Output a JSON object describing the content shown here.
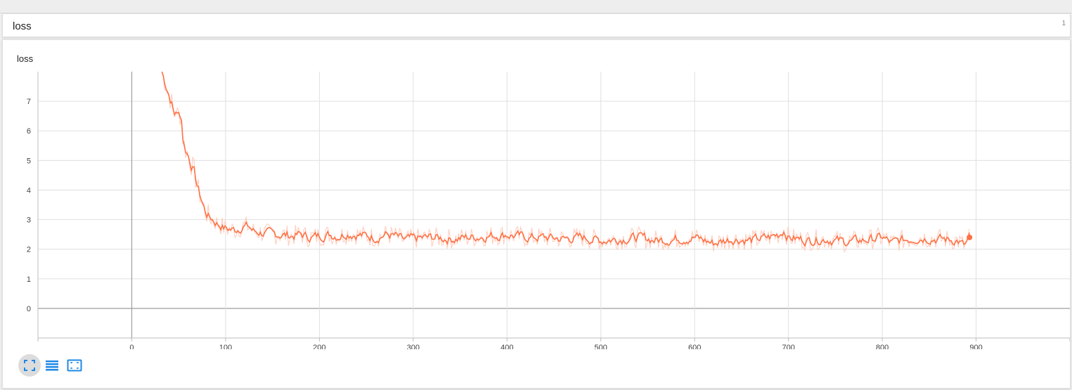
{
  "group": {
    "title": "loss",
    "count": "1"
  },
  "card": {
    "title": "loss"
  },
  "icons": {
    "fullscreen": "fullscreen-icon",
    "log_scale": "log-scale-icon",
    "fit_domain": "fit-domain-icon"
  },
  "colors": {
    "line": "#ff7043",
    "raw_line": "#ffccbc",
    "icon": "#1e88e5"
  },
  "chart_data": {
    "type": "line",
    "title": "loss",
    "xlabel": "",
    "ylabel": "",
    "xlim": [
      -100,
      1000
    ],
    "ylim": [
      -1,
      8
    ],
    "xticks": [
      0,
      100,
      200,
      300,
      400,
      500,
      600,
      700,
      800,
      900
    ],
    "yticks": [
      0,
      1,
      2,
      3,
      4,
      5,
      6,
      7
    ],
    "grid": true,
    "series": [
      {
        "values_smoothed": "approx",
        "x": [
          32,
          37,
          40,
          43,
          45,
          47,
          49,
          51,
          53,
          55,
          57,
          60,
          63,
          66,
          70,
          72,
          75,
          78,
          82,
          85,
          88,
          92,
          95,
          100,
          110,
          120,
          125,
          130,
          140,
          150,
          160,
          170,
          180,
          190,
          200,
          210,
          220,
          230,
          240,
          250,
          260,
          270,
          280,
          290,
          300,
          320,
          340,
          360,
          380,
          400,
          420,
          440,
          460,
          480,
          500,
          520,
          540,
          560,
          580,
          600,
          620,
          640,
          660,
          680,
          690,
          695,
          700,
          720,
          740,
          760,
          780,
          800,
          810,
          820,
          830,
          840,
          860,
          880,
          888,
          893
        ],
        "y": [
          8.0,
          7.5,
          7.2,
          6.9,
          6.5,
          6.7,
          6.5,
          6.6,
          6.4,
          5.6,
          5.4,
          5.2,
          4.9,
          4.7,
          4.1,
          3.9,
          3.6,
          3.3,
          3.1,
          3.05,
          2.95,
          2.85,
          2.8,
          2.7,
          2.65,
          2.8,
          2.75,
          2.6,
          2.55,
          2.5,
          2.5,
          2.45,
          2.5,
          2.4,
          2.45,
          2.5,
          2.45,
          2.55,
          2.5,
          2.45,
          2.4,
          2.5,
          2.45,
          2.3,
          2.35,
          2.4,
          2.35,
          2.4,
          2.45,
          2.5,
          2.4,
          2.4,
          2.35,
          2.4,
          2.3,
          2.35,
          2.4,
          2.3,
          2.35,
          2.4,
          2.2,
          2.35,
          2.3,
          2.4,
          2.5,
          2.65,
          2.4,
          2.3,
          2.35,
          2.25,
          2.3,
          2.4,
          2.2,
          2.3,
          2.35,
          2.4,
          2.35,
          2.3,
          2.1,
          2.4
        ]
      }
    ]
  }
}
